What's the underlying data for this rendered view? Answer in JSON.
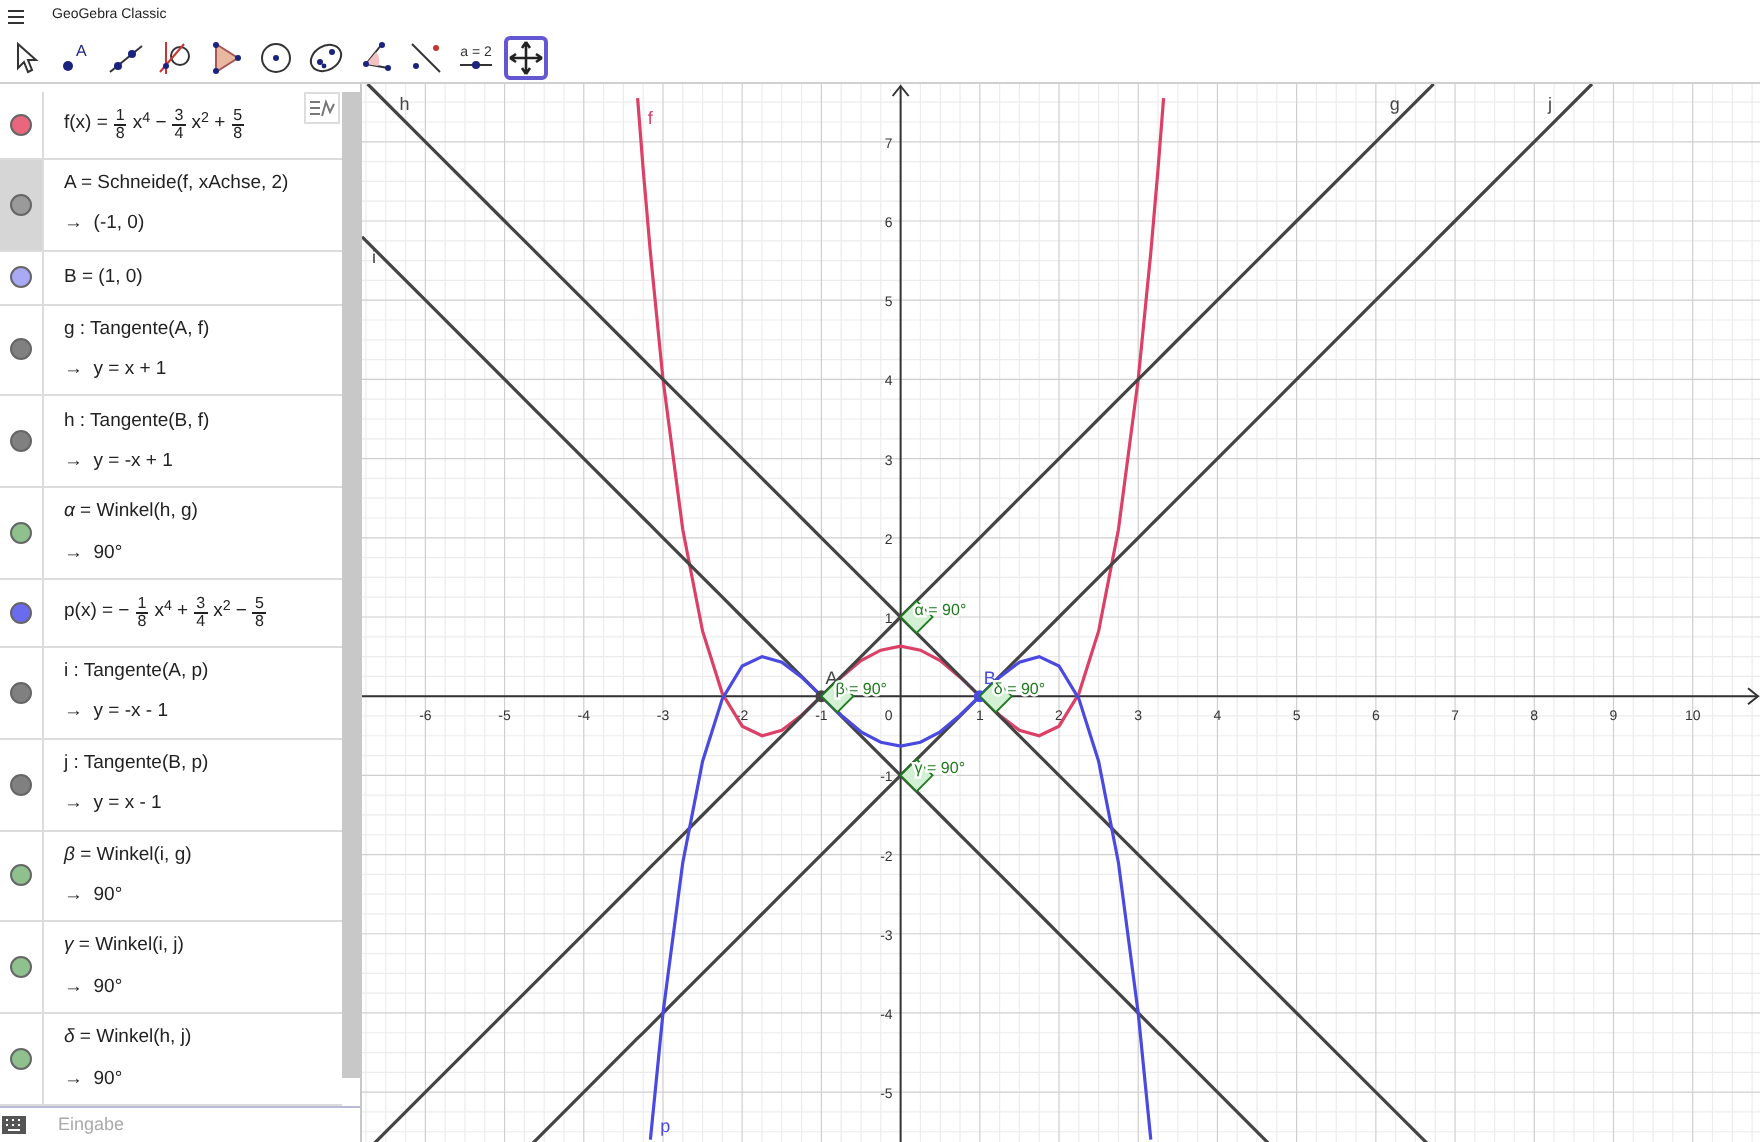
{
  "window": {
    "title": "GeoGebra Classic"
  },
  "toolbar": {
    "tools": [
      {
        "kind": "pointer",
        "selected": false
      },
      {
        "kind": "point",
        "label": "A",
        "selected": false
      },
      {
        "kind": "line",
        "selected": false
      },
      {
        "kind": "tangent",
        "selected": false
      },
      {
        "kind": "polygon",
        "selected": false
      },
      {
        "kind": "circle",
        "selected": false
      },
      {
        "kind": "ellipse",
        "selected": false
      },
      {
        "kind": "angle",
        "selected": false
      },
      {
        "kind": "reflect",
        "selected": false
      },
      {
        "kind": "slider",
        "label": "a = 2",
        "selected": false
      },
      {
        "kind": "move",
        "selected": true
      }
    ]
  },
  "algebra": {
    "rows": [
      {
        "color": "#e8677f",
        "selected": false,
        "definition": [
          {
            "kind": "text",
            "text": "f(x) ="
          },
          {
            "kind": "frac",
            "num": "1",
            "den": "8"
          },
          {
            "kind": "text",
            "text": "x$^{4}$ −"
          },
          {
            "kind": "frac",
            "num": "3",
            "den": "4"
          },
          {
            "kind": "text",
            "text": "x$^{2}$ +"
          },
          {
            "kind": "frac",
            "num": "5",
            "den": "8"
          }
        ]
      },
      {
        "color": "#9a9a9a",
        "selected": true,
        "definition": [
          {
            "kind": "text",
            "text": "A = Schneide(f, xAchse, 2)"
          }
        ],
        "result": "→  (-1, 0)"
      },
      {
        "color": "#a9a9f5",
        "selected": false,
        "definition": [
          {
            "kind": "text",
            "text": "B = (1, 0)"
          }
        ]
      },
      {
        "color": "#808080",
        "selected": false,
        "definition": [
          {
            "kind": "text",
            "text": "g : Tangente(A, f)"
          }
        ],
        "result": "→  y = x + 1"
      },
      {
        "color": "#808080",
        "selected": false,
        "definition": [
          {
            "kind": "text",
            "text": "h : Tangente(B, f)"
          }
        ],
        "result": "→  y = -x + 1"
      },
      {
        "color": "#8fc18f",
        "selected": false,
        "definition": [
          {
            "kind": "text",
            "text": "*α* = Winkel(h, g)"
          }
        ],
        "result": "→  90°"
      },
      {
        "color": "#6b6bf0",
        "selected": false,
        "definition": [
          {
            "kind": "text",
            "text": "p(x) = −"
          },
          {
            "kind": "frac",
            "num": "1",
            "den": "8"
          },
          {
            "kind": "text",
            "text": "x$^{4}$ +"
          },
          {
            "kind": "frac",
            "num": "3",
            "den": "4"
          },
          {
            "kind": "text",
            "text": "x$^{2}$ −"
          },
          {
            "kind": "frac",
            "num": "5",
            "den": "8"
          }
        ]
      },
      {
        "color": "#808080",
        "selected": false,
        "definition": [
          {
            "kind": "text",
            "text": "i : Tangente(A, p)"
          }
        ],
        "result": "→  y = -x - 1"
      },
      {
        "color": "#808080",
        "selected": false,
        "definition": [
          {
            "kind": "text",
            "text": "j : Tangente(B, p)"
          }
        ],
        "result": "→  y = x - 1"
      },
      {
        "color": "#8fc18f",
        "selected": false,
        "definition": [
          {
            "kind": "text",
            "text": "*β* = Winkel(i, g)"
          }
        ],
        "result": "→  90°"
      },
      {
        "color": "#8fc18f",
        "selected": false,
        "definition": [
          {
            "kind": "text",
            "text": "*γ* = Winkel(i, j)"
          }
        ],
        "result": "→  90°"
      },
      {
        "color": "#8fc18f",
        "selected": false,
        "definition": [
          {
            "kind": "text",
            "text": "*δ* = Winkel(h, j)"
          }
        ],
        "result": "→  90°"
      }
    ],
    "input": {
      "placeholder": "Eingabe"
    }
  },
  "graphics": {
    "origin_label": "0",
    "chart_data": {
      "type": "line",
      "x": [
        -6.8,
        -6.73,
        -6.68,
        -6,
        -5,
        -4.68,
        -4,
        -3.32,
        -3.25,
        -3.16,
        -3,
        -2.75,
        -2.5,
        -2.25,
        -2,
        -1.75,
        -1.5,
        -1.25,
        -1,
        -0.75,
        -0.5,
        -0.25,
        0,
        0.25,
        0.5,
        0.75,
        1,
        1.25,
        1.5,
        1.75,
        2,
        2.25,
        2.5,
        2.75,
        3,
        3.16,
        3.25,
        3.32,
        4,
        4.68,
        5,
        6,
        6.68,
        6.73,
        7,
        8,
        8.73
      ],
      "series": [
        {
          "name": "f",
          "color": "#dc4066",
          "values": [
            null,
            null,
            null,
            null,
            null,
            null,
            null,
            7.55,
            6.65,
            5.6,
            4,
            2.1,
            0.82,
            0.03,
            -0.38,
            -0.5,
            -0.43,
            -0.24,
            0,
            0.24,
            0.45,
            0.58,
            0.63,
            0.58,
            0.45,
            0.24,
            0,
            -0.24,
            -0.43,
            -0.5,
            -0.38,
            0.03,
            0.82,
            2.1,
            4,
            5.6,
            6.65,
            7.55,
            null,
            null,
            null,
            null,
            null,
            null,
            null,
            null,
            null
          ]
        },
        {
          "name": "g",
          "color": "#444444",
          "values": [
            null,
            null,
            -5.68,
            -5,
            -4,
            -3.68,
            -3,
            -2.32,
            -2.25,
            -2.16,
            -2,
            -1.75,
            -1.5,
            -1.25,
            -1,
            -0.75,
            -0.5,
            -0.25,
            0,
            0.25,
            0.5,
            0.75,
            1,
            1.25,
            1.5,
            1.75,
            2,
            2.25,
            2.5,
            2.75,
            3,
            3.25,
            3.5,
            3.75,
            4,
            4.16,
            4.25,
            4.32,
            5,
            5.68,
            6,
            7,
            7.68,
            7.73,
            null,
            null,
            null
          ]
        },
        {
          "name": "h",
          "color": "#444444",
          "values": [
            null,
            7.73,
            7.68,
            7,
            6,
            5.68,
            5,
            4.32,
            4.25,
            4.16,
            4,
            3.75,
            3.5,
            3.25,
            3,
            2.75,
            2.5,
            2.25,
            2,
            1.75,
            1.5,
            1.25,
            1,
            0.75,
            0.5,
            0.25,
            0,
            -0.25,
            -0.5,
            -0.75,
            -1,
            -1.25,
            -1.5,
            -1.75,
            -2,
            -2.16,
            -2.25,
            -2.32,
            -3,
            -3.68,
            -4,
            -5,
            -5.68,
            null,
            null,
            null,
            null
          ]
        },
        {
          "name": "i",
          "color": "#444444",
          "values": [
            5.8,
            5.73,
            5.68,
            5,
            4,
            3.68,
            3,
            2.32,
            2.25,
            2.16,
            2,
            1.75,
            1.5,
            1.25,
            1,
            0.75,
            0.5,
            0.25,
            0,
            -0.25,
            -0.5,
            -0.75,
            -1,
            -1.25,
            -1.5,
            -1.75,
            -2,
            -2.25,
            -2.5,
            -2.75,
            -3,
            -3.25,
            -3.5,
            -3.75,
            -4,
            -4.16,
            -4.25,
            -4.32,
            -5,
            -5.68,
            null,
            null,
            null,
            null,
            null,
            null,
            null
          ]
        },
        {
          "name": "j",
          "color": "#444444",
          "values": [
            null,
            null,
            null,
            null,
            null,
            -5.68,
            -5,
            -4.32,
            -4.25,
            -4.16,
            -4,
            -3.75,
            -3.5,
            -3.25,
            -3,
            -2.75,
            -2.5,
            -2.25,
            -2,
            -1.75,
            -1.5,
            -1.25,
            -1,
            -0.75,
            -0.5,
            -0.25,
            0,
            0.25,
            0.5,
            0.75,
            1,
            1.25,
            1.5,
            1.75,
            2,
            2.16,
            2.25,
            2.32,
            3,
            3.68,
            4,
            5,
            5.68,
            5.73,
            6,
            7,
            7.73
          ]
        },
        {
          "name": "p",
          "color": "#4a4ae0",
          "values": [
            null,
            null,
            null,
            null,
            null,
            null,
            null,
            null,
            null,
            -5.6,
            -4,
            -2.1,
            -0.82,
            -0.03,
            0.38,
            0.5,
            0.43,
            0.24,
            0,
            -0.24,
            -0.45,
            -0.58,
            -0.63,
            -0.58,
            -0.45,
            -0.24,
            0,
            0.24,
            0.43,
            0.5,
            0.38,
            -0.03,
            -0.82,
            -2.1,
            -4,
            -5.6,
            null,
            null,
            null,
            null,
            null,
            null,
            null,
            null,
            null,
            null,
            null
          ]
        },
        {
          "name": "A",
          "color": "#444444",
          "marker": true,
          "values": [
            null,
            null,
            null,
            null,
            null,
            null,
            null,
            null,
            null,
            null,
            null,
            null,
            null,
            null,
            null,
            null,
            null,
            null,
            0,
            null,
            null,
            null,
            null,
            null,
            null,
            null,
            null,
            null,
            null,
            null,
            null,
            null,
            null,
            null,
            null,
            null,
            null,
            null,
            null,
            null,
            null,
            null,
            null,
            null,
            null,
            null,
            null
          ]
        },
        {
          "name": "B",
          "color": "#4a4ae0",
          "marker": true,
          "values": [
            null,
            null,
            null,
            null,
            null,
            null,
            null,
            null,
            null,
            null,
            null,
            null,
            null,
            null,
            null,
            null,
            null,
            null,
            null,
            null,
            null,
            null,
            null,
            null,
            null,
            null,
            0,
            null,
            null,
            null,
            null,
            null,
            null,
            null,
            null,
            null,
            null,
            null,
            null,
            null,
            null,
            null,
            null,
            null,
            null,
            null,
            null
          ]
        }
      ],
      "annotations": [
        {
          "text": "α = 90°",
          "x": 0,
          "y": 1
        },
        {
          "text": "β = 90°",
          "x": -1,
          "y": 0
        },
        {
          "text": "γ = 90°",
          "x": 0,
          "y": -1
        },
        {
          "text": "δ = 90°",
          "x": 1,
          "y": 0
        }
      ],
      "xlim": [
        -6.8,
        10.85
      ],
      "ylim": [
        -5.68,
        7.73
      ],
      "grid": true,
      "xticks": [
        -6,
        -5,
        -4,
        -3,
        -2,
        -1,
        1,
        2,
        3,
        4,
        5,
        6,
        7,
        8,
        9,
        10
      ],
      "yticks": [
        -5,
        -4,
        -3,
        -2,
        -1,
        1,
        2,
        3,
        4,
        5,
        6,
        7
      ]
    }
  }
}
